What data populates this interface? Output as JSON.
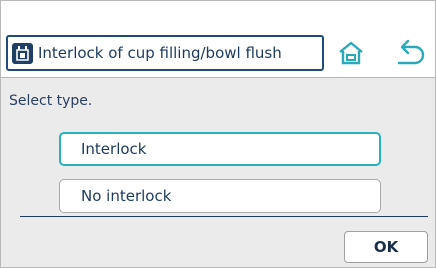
{
  "header": {
    "title": "Interlock of cup filling/bowl flush",
    "title_icon": "cup-filler-icon",
    "home_icon": "home-icon",
    "back_icon": "back-arrow-icon"
  },
  "main": {
    "prompt": "Select  type.",
    "options": [
      {
        "label": "Interlock",
        "selected": true
      },
      {
        "label": "No interlock",
        "selected": false
      }
    ]
  },
  "footer": {
    "ok_label": "OK"
  },
  "colors": {
    "accent": "#2bb0bf",
    "brand": "#1f4a7a",
    "text": "#1d3a5e"
  }
}
